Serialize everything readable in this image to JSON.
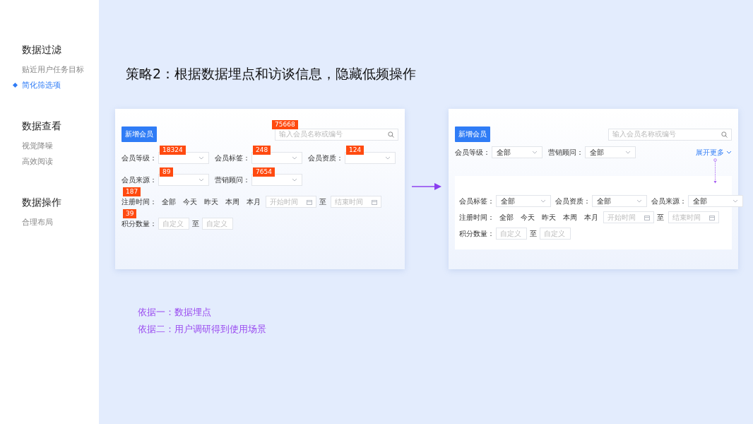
{
  "sidebar": {
    "sections": [
      {
        "title": "数据过滤",
        "items": [
          {
            "label": "贴近用户任务目标",
            "selected": false
          },
          {
            "label": "简化筛选项",
            "selected": true
          }
        ]
      },
      {
        "title": "数据查看",
        "items": [
          {
            "label": "视觉降噪",
            "selected": false
          },
          {
            "label": "高效阅读",
            "selected": false
          }
        ]
      },
      {
        "title": "数据操作",
        "items": [
          {
            "label": "合理布局",
            "selected": false
          }
        ]
      }
    ]
  },
  "title": "策略2：根据数据埋点和访谈信息，隐藏低频操作",
  "mockups": [
    {
      "button": "新增会员",
      "search": {
        "placeholder": "输入会员名称或编号",
        "badge": "75668"
      },
      "rows": [
        [
          {
            "kind": "select",
            "label": "会员等级：",
            "badge": "18324"
          },
          {
            "kind": "select",
            "label": "会员标签：",
            "badge": "248"
          },
          {
            "kind": "select",
            "label": "会员资质：",
            "badge": "124"
          }
        ],
        [
          {
            "kind": "select",
            "label": "会员来源：",
            "badge": "89"
          },
          {
            "kind": "select",
            "label": "营销顾问：",
            "badge": "7654"
          }
        ],
        [
          {
            "kind": "time",
            "label": "注册时间：",
            "badge": "187",
            "options": [
              "全部",
              "今天",
              "昨天",
              "本周",
              "本月"
            ],
            "start": "开始时间",
            "sep": "至",
            "end": "结束时间"
          }
        ],
        [
          {
            "kind": "range",
            "label": "积分数量：",
            "badge": "39",
            "from": "自定义",
            "sep": "至",
            "to": "自定义"
          }
        ]
      ]
    },
    {
      "button": "新增会员",
      "search": {
        "placeholder": "输入会员名称或编号"
      },
      "rows": [
        [
          {
            "kind": "select",
            "label": "会员等级：",
            "value": "全部"
          },
          {
            "kind": "select",
            "label": "营销顾问：",
            "value": "全部"
          }
        ]
      ],
      "expand": "展开更多",
      "panel_rows": [
        [
          {
            "kind": "select",
            "label": "会员标签：",
            "value": "全部"
          },
          {
            "kind": "select",
            "label": "会员资质：",
            "value": "全部"
          },
          {
            "kind": "select",
            "label": "会员来源：",
            "value": "全部"
          }
        ],
        [
          {
            "kind": "time",
            "label": "注册时间：",
            "options": [
              "全部",
              "今天",
              "昨天",
              "本周",
              "本月"
            ],
            "start": "开始时间",
            "sep": "至",
            "end": "结束时间"
          }
        ],
        [
          {
            "kind": "range",
            "label": "积分数量：",
            "from": "自定义",
            "sep": "至",
            "to": "自定义"
          }
        ]
      ]
    }
  ],
  "notes": [
    "依据一：数据埋点",
    "依据二：用户调研得到使用场景"
  ]
}
